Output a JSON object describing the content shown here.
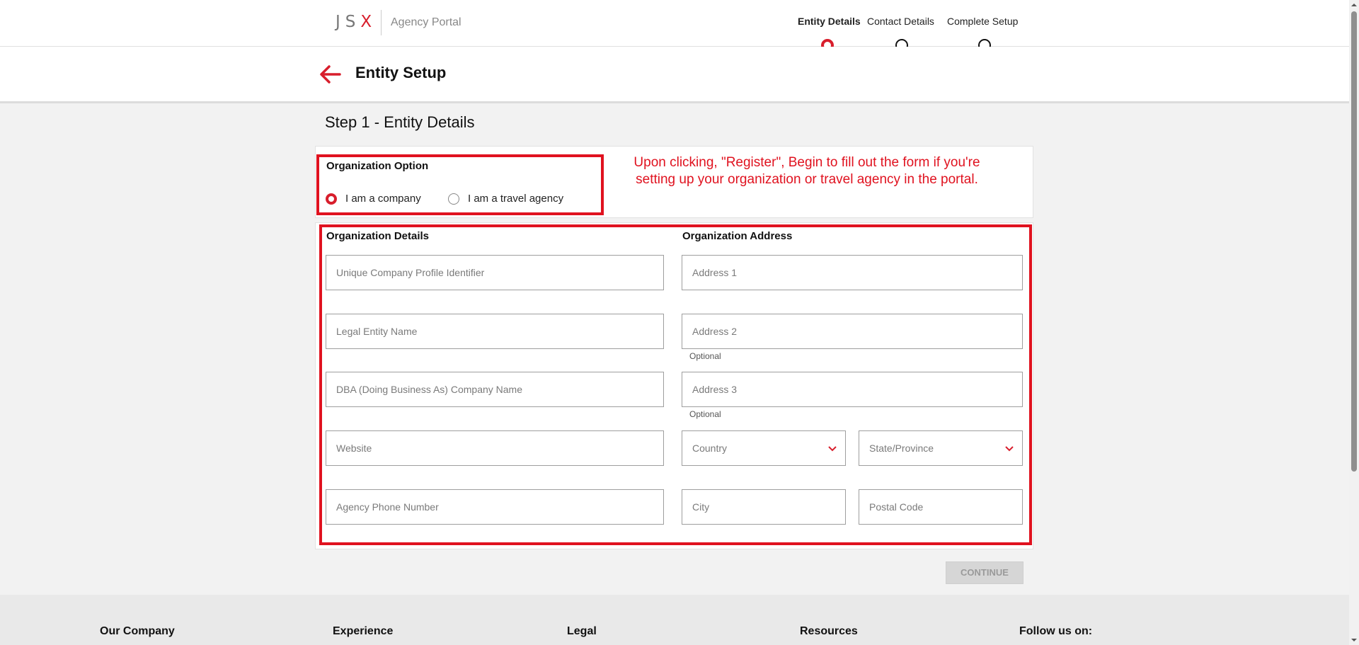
{
  "header": {
    "logo_letters": "JS",
    "logo_x": "X",
    "portal_name": "Agency Portal",
    "steps": [
      {
        "label": "Entity Details",
        "active": true
      },
      {
        "label": "Contact Details",
        "active": false
      },
      {
        "label": "Complete Setup",
        "active": false
      }
    ]
  },
  "subheader": {
    "title": "Entity Setup",
    "back_icon": "arrow-left-icon"
  },
  "form": {
    "step_heading": "Step 1 - Entity Details",
    "organization_option": {
      "label": "Organization Option",
      "options": [
        {
          "label": "I am a company",
          "checked": true
        },
        {
          "label": "I am a travel agency",
          "checked": false
        }
      ]
    },
    "annotation": "Upon clicking, \"Register\", Begin to fill out the form if you're setting up your organization or travel agency in the portal.",
    "details": {
      "label": "Organization Details",
      "fields": [
        {
          "placeholder": "Unique Company Profile Identifier",
          "value": ""
        },
        {
          "placeholder": "Legal Entity Name",
          "value": ""
        },
        {
          "placeholder": "DBA (Doing Business As) Company Name",
          "value": ""
        },
        {
          "placeholder": "Website",
          "value": ""
        },
        {
          "placeholder": "Agency Phone Number",
          "value": ""
        }
      ]
    },
    "address": {
      "label": "Organization Address",
      "address1": {
        "placeholder": "Address 1",
        "value": ""
      },
      "address2": {
        "placeholder": "Address 2",
        "value": "",
        "helper": "Optional"
      },
      "address3": {
        "placeholder": "Address 3",
        "value": "",
        "helper": "Optional"
      },
      "country": {
        "label": "Country"
      },
      "state": {
        "label": "State/Province"
      },
      "city": {
        "placeholder": "City",
        "value": ""
      },
      "postal": {
        "placeholder": "Postal Code",
        "value": ""
      }
    },
    "continue_label": "CONTINUE"
  },
  "footer": {
    "columns": [
      "Our Company",
      "Experience",
      "Legal",
      "Resources",
      "Follow us on:"
    ]
  },
  "colors": {
    "accent": "#d81e2c",
    "annotation": "#e0121f"
  }
}
